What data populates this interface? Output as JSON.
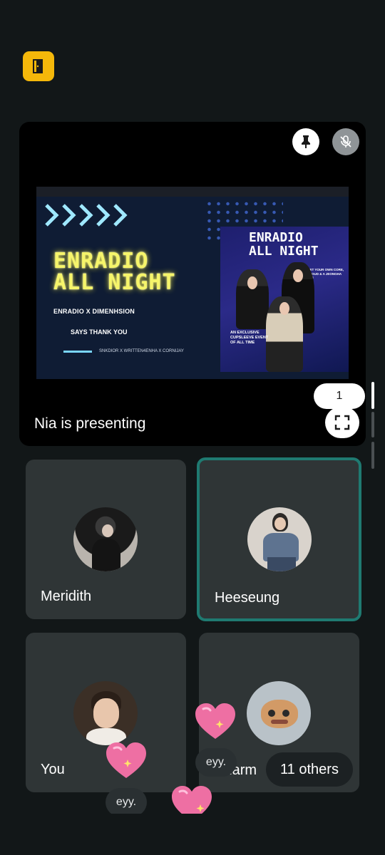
{
  "header": {
    "leave_icon": "door-exit-icon",
    "leave_color": "#f5b80a"
  },
  "presentation": {
    "presenting_label": "Nia is presenting",
    "page_number": "1",
    "pin_icon": "pin-icon",
    "mic_icon": "mic-off-icon",
    "fullscreen_icon": "fullscreen-icon",
    "slide": {
      "title_line1": "ENRADIO",
      "title_line2": "ALL NIGHT",
      "subtitle": "ENRADIO X DIMENHSION",
      "thanks": "SAYS THANK YOU",
      "credit": "SNKDIOR X WRITTEN4ENHA X CORNIJAY",
      "poster_title_line1": "ENRADIO",
      "poster_title_line2": "ALL NIGHT",
      "poster_side": "GET YOUR OWN CORE, CLOUD & A JEONGHA KIT!",
      "poster_note": "AN EXCLUSIVE CUPSLEEVE EVENT OF ALL TIME"
    }
  },
  "participants": [
    {
      "name": "Meridith",
      "speaking": false
    },
    {
      "name": "Heeseung",
      "speaking": true
    },
    {
      "name": "You",
      "speaking": false
    },
    {
      "name": "Charm",
      "speaking": false
    }
  ],
  "others_label": "11 others",
  "reactions": [
    {
      "emoji": "sparkling-heart-icon"
    },
    {
      "emoji": "sparkling-heart-icon"
    },
    {
      "emoji": "sparkling-heart-icon"
    }
  ],
  "messages": [
    "eyy.",
    "eyy."
  ],
  "colors": {
    "background": "#121718",
    "tile": "#2f3536",
    "active_border": "#1f7a71"
  }
}
